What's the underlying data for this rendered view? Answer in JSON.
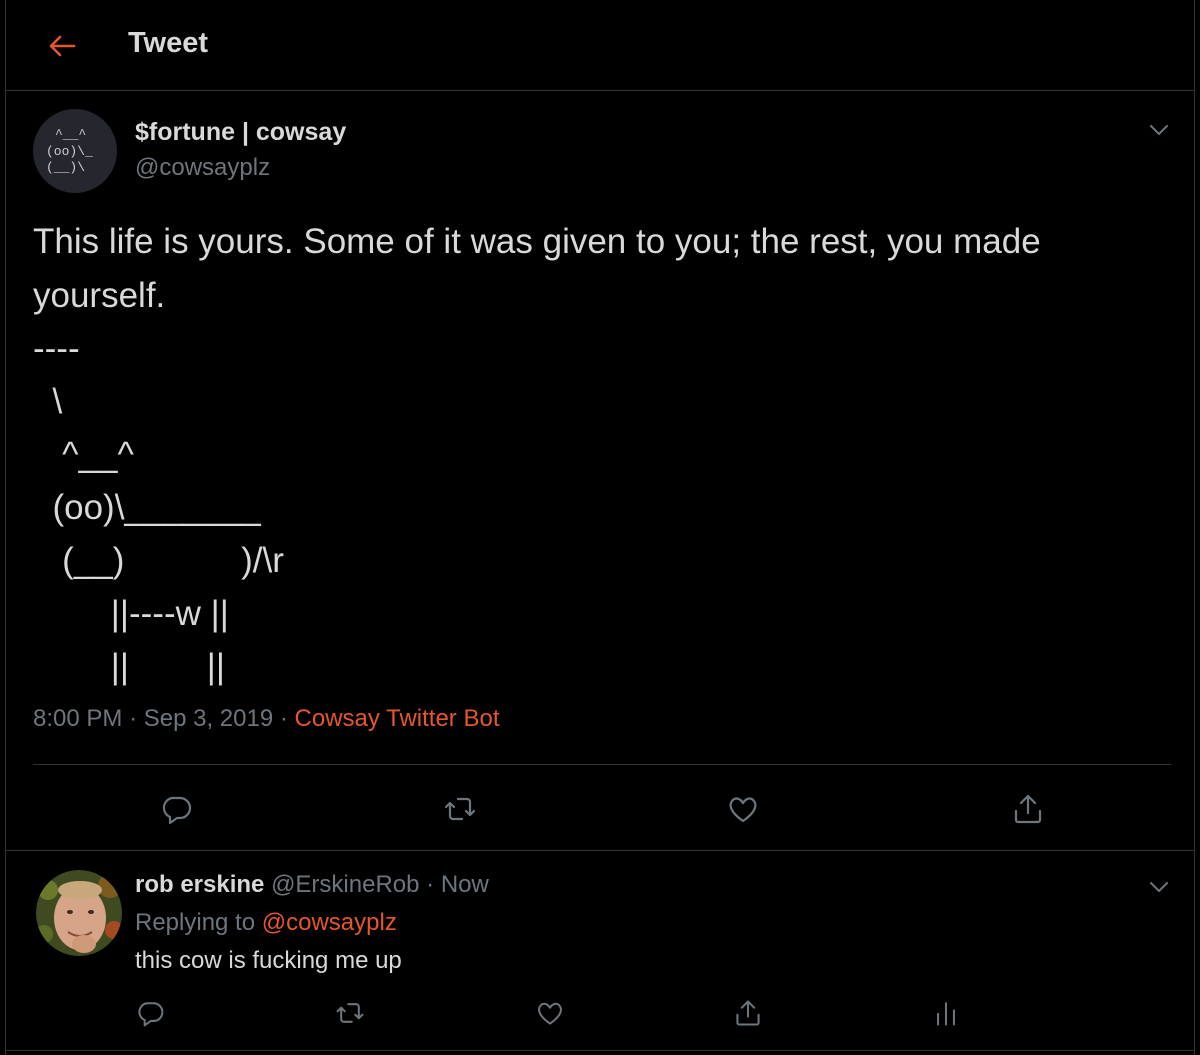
{
  "header": {
    "title": "Tweet"
  },
  "colors": {
    "accent": "#e4572e",
    "text": "#d9d9d9",
    "muted": "#6e767d",
    "border": "#2f3336",
    "background": "#000000"
  },
  "tweet": {
    "display_name": "$fortune | cowsay",
    "handle": "@cowsayplz",
    "text": "This life is yours.  Some of it was given to you; the rest, you made yourself.",
    "ascii_art": "----\n  \\\n   ^__^\n  (oo)\\_______\n   (__)            )/\\r\n        ||----w ||\n        ||        ||",
    "avatar_ascii": [
      "^__^",
      "(oo)\\_",
      "(__)\\"
    ],
    "time": "8:00 PM",
    "separator": "·",
    "date": "Sep 3, 2019",
    "source": "Cowsay Twitter Bot",
    "actions": [
      "reply-icon",
      "retweet-icon",
      "like-icon",
      "share-icon"
    ]
  },
  "reply": {
    "display_name": "rob erskine",
    "handle": "@ErskineRob",
    "separator": "·",
    "time": "Now",
    "replying_prefix": "Replying to",
    "replying_to": "@cowsayplz",
    "text": "this cow is fucking me up",
    "actions": [
      "reply-icon",
      "retweet-icon",
      "like-icon",
      "share-icon",
      "analytics-icon"
    ]
  }
}
